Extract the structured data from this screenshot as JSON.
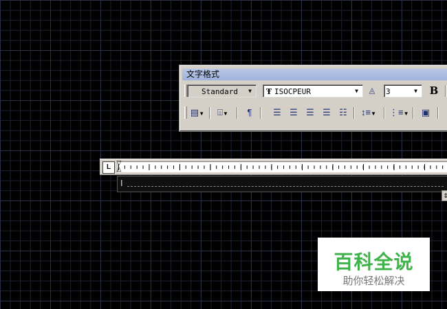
{
  "toolbar": {
    "title": "文字格式",
    "style_value": "Standard",
    "font_value": "ISOCPEUR",
    "font_prefix_icon": "truetype-icon",
    "height_value": "3",
    "bold_label": "B",
    "row2_icons": [
      "columns-icon",
      "mtext-justify-icon",
      "paragraph-icon",
      "align-left-icon",
      "align-center-icon",
      "align-right-icon",
      "justify-icon",
      "distribute-icon",
      "line-spacing-icon",
      "numbering-icon",
      "insert-field-icon"
    ]
  },
  "ruler": {
    "tab_label": "L"
  },
  "watermark": {
    "title": "百科全说",
    "subtitle": "助你轻松解决"
  },
  "colors": {
    "canvas_bg": "#000000",
    "toolbar_bg": "#d4d0c8",
    "title_bar": "#a8b8e0",
    "watermark_green": "#3fb24a"
  }
}
